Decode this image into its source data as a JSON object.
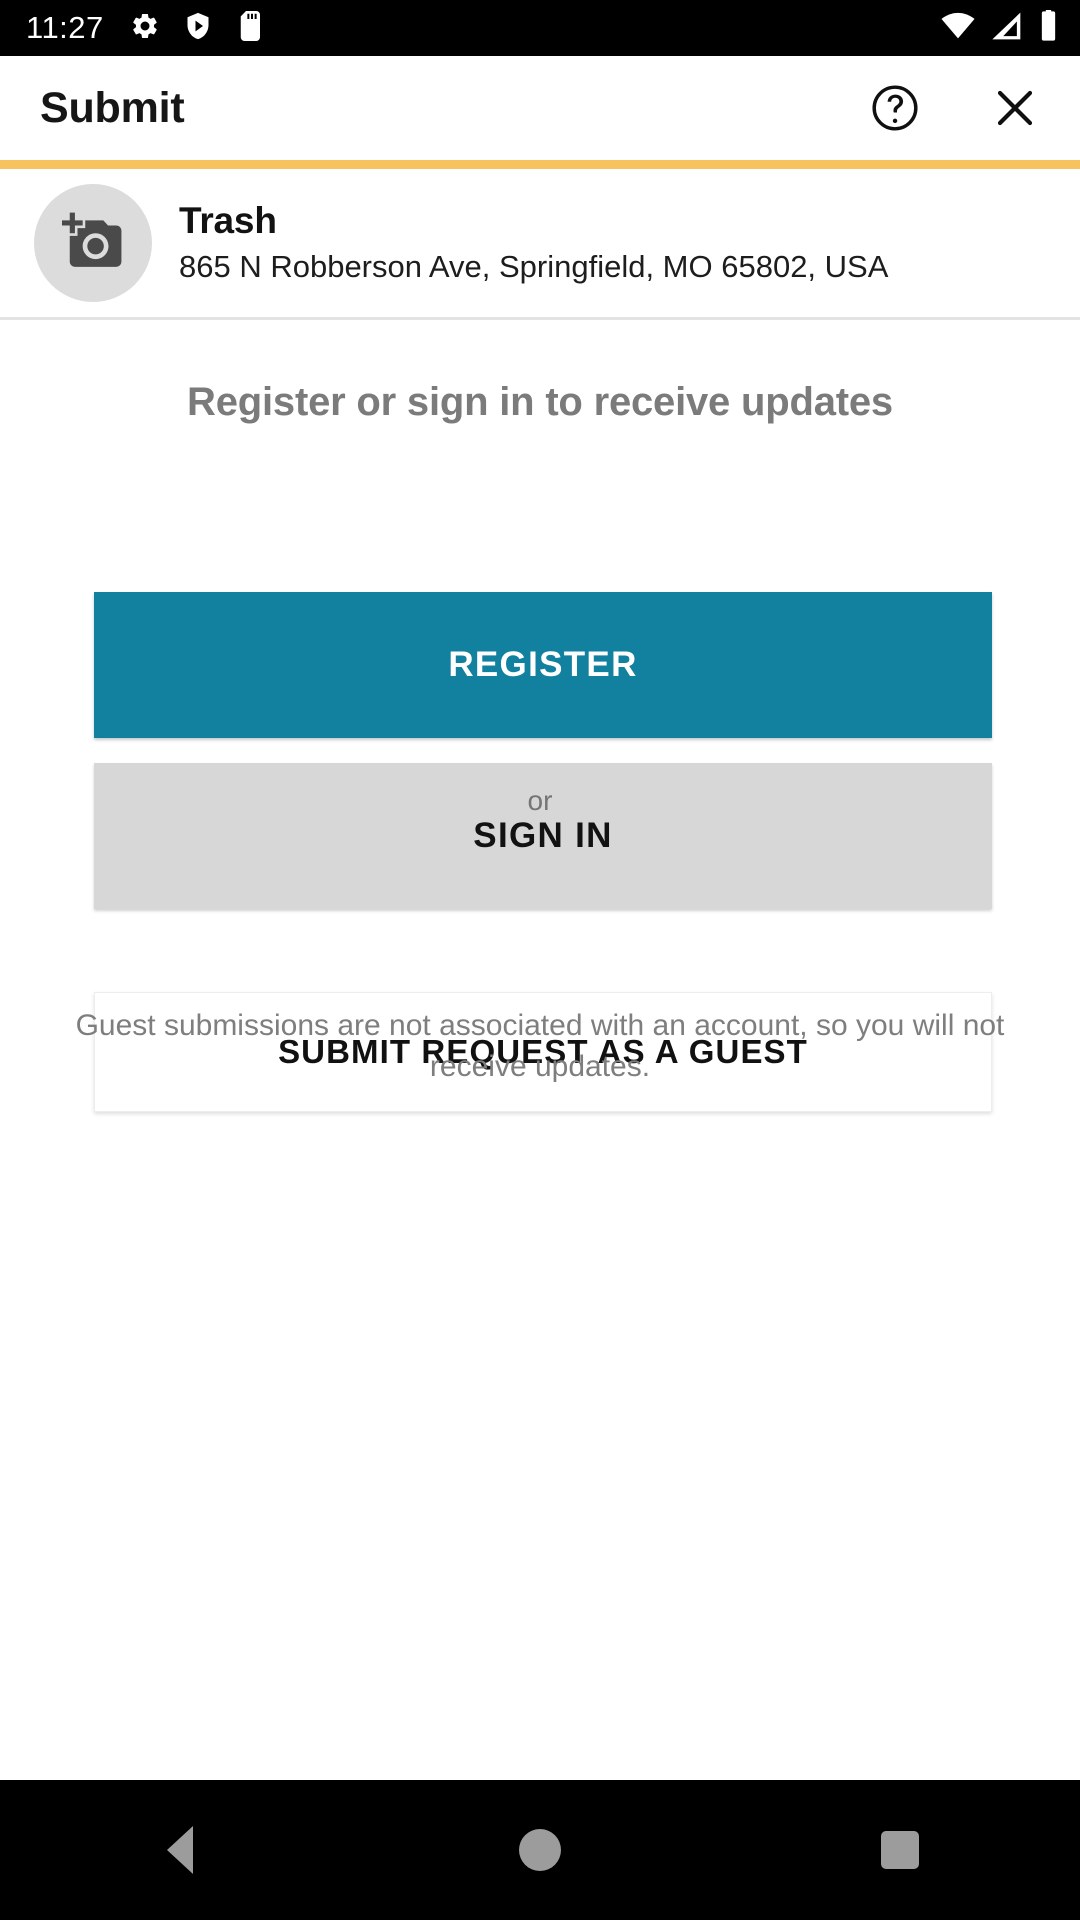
{
  "status_bar": {
    "time": "11:27",
    "left_icons": [
      "gear-icon",
      "play-protect-shield-icon",
      "sd-card-icon"
    ],
    "right_icons": [
      "wifi-icon",
      "cellular-signal-icon",
      "battery-icon"
    ]
  },
  "app_bar": {
    "title": "Submit",
    "help_icon": "help-circle-icon",
    "close_icon": "close-icon"
  },
  "accent_color": "#f7c35f",
  "request_card": {
    "thumbnail_icon": "add-a-photo-icon",
    "title": "Trash",
    "address": "865 N Robberson Ave, Springfield, MO 65802, USA"
  },
  "auth": {
    "heading": "Register or sign in to receive updates",
    "register_label": "REGISTER",
    "register_color": "#12809f",
    "sign_in_label": "SIGN IN",
    "sign_in_color": "#d7d7d7",
    "or_label": "or",
    "guest_label": "SUBMIT REQUEST AS A GUEST",
    "guest_note": "Guest submissions are not associated with an account, so you will not receive updates."
  },
  "nav_bar": {
    "back": "back-nav-icon",
    "home": "home-nav-icon",
    "recents": "recents-nav-icon"
  }
}
